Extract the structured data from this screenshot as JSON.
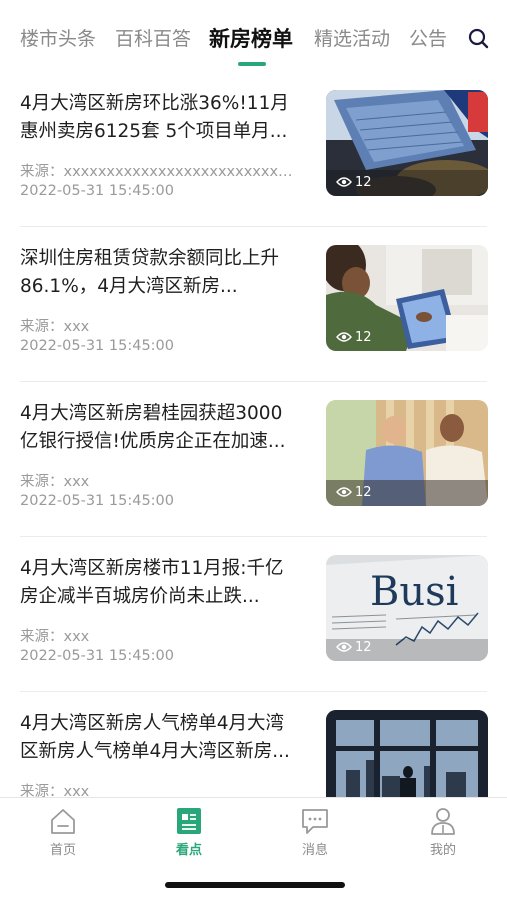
{
  "top_tabs": [
    {
      "label": "楼市头条"
    },
    {
      "label": "百科百答"
    },
    {
      "label": "新房榜单"
    },
    {
      "label": "精选活动"
    },
    {
      "label": "公告"
    }
  ],
  "active_tab": "新房榜单",
  "articles": [
    {
      "title": "4月大湾区新房环比涨36%!11月惠州卖房6125套 5个项目单月...",
      "source": "来源：xxxxxxxxxxxxxxxxxxxxxxxxxxxxxxxxx",
      "time": "2022-05-31 15:45:00",
      "views": "12",
      "image": "laptop-keyboard-photo"
    },
    {
      "title": "深圳住房租赁贷款余额同比上升86.1%，4月大湾区新房...",
      "source": "来源：xxx",
      "time": "2022-05-31 15:45:00",
      "views": "12",
      "image": "woman-with-tablet-photo"
    },
    {
      "title": "4月大湾区新房碧桂园获超3000亿银行授信!优质房企正在加速...",
      "source": "来源：xxx",
      "time": "2022-05-31 15:45:00",
      "views": "12",
      "image": "business-meeting-photo"
    },
    {
      "title": "4月大湾区新房楼市11月报:千亿房企减半百城房价尚未止跌...",
      "source": "来源：xxx",
      "time": "2022-05-31 15:45:00",
      "views": "12",
      "image": "business-newspaper-photo",
      "image_text": "Busi"
    },
    {
      "title": "4月大湾区新房人气榜单4月大湾区新房人气榜单4月大湾区新房...",
      "source": "来源：xxx",
      "time": "",
      "views": "",
      "image": "city-window-photo"
    }
  ],
  "bottom_nav": [
    {
      "label": "首页",
      "icon": "home-icon"
    },
    {
      "label": "看点",
      "icon": "article-icon"
    },
    {
      "label": "消息",
      "icon": "message-icon"
    },
    {
      "label": "我的",
      "icon": "profile-icon"
    }
  ],
  "active_nav": "看点",
  "colors": {
    "accent": "#2aa77a",
    "text_primary": "#1f1f1f",
    "text_secondary": "#9a9a9a"
  }
}
